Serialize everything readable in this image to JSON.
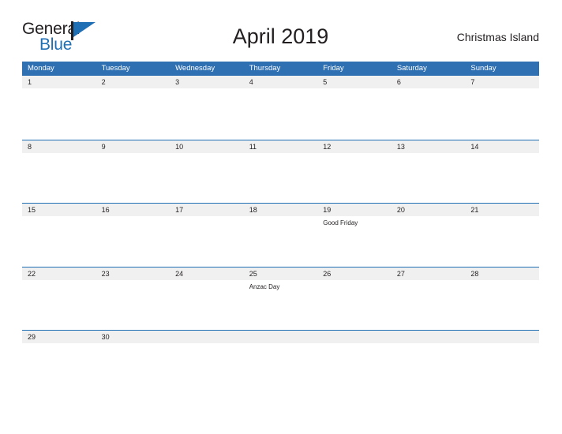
{
  "brand": {
    "name_part1": "General",
    "name_part2": "Blue",
    "accent_color": "#1f6fb5"
  },
  "header": {
    "title": "April 2019",
    "location": "Christmas Island"
  },
  "calendar": {
    "header_bg": "#2f70b3",
    "band_bg": "#f0f0f0",
    "rule_color": "#1f6fb5",
    "weekdays": [
      "Monday",
      "Tuesday",
      "Wednesday",
      "Thursday",
      "Friday",
      "Saturday",
      "Sunday"
    ],
    "weeks": [
      [
        {
          "date": "1",
          "events": []
        },
        {
          "date": "2",
          "events": []
        },
        {
          "date": "3",
          "events": []
        },
        {
          "date": "4",
          "events": []
        },
        {
          "date": "5",
          "events": []
        },
        {
          "date": "6",
          "events": []
        },
        {
          "date": "7",
          "events": []
        }
      ],
      [
        {
          "date": "8",
          "events": []
        },
        {
          "date": "9",
          "events": []
        },
        {
          "date": "10",
          "events": []
        },
        {
          "date": "11",
          "events": []
        },
        {
          "date": "12",
          "events": []
        },
        {
          "date": "13",
          "events": []
        },
        {
          "date": "14",
          "events": []
        }
      ],
      [
        {
          "date": "15",
          "events": []
        },
        {
          "date": "16",
          "events": []
        },
        {
          "date": "17",
          "events": []
        },
        {
          "date": "18",
          "events": []
        },
        {
          "date": "19",
          "events": [
            "Good Friday"
          ]
        },
        {
          "date": "20",
          "events": []
        },
        {
          "date": "21",
          "events": []
        }
      ],
      [
        {
          "date": "22",
          "events": []
        },
        {
          "date": "23",
          "events": []
        },
        {
          "date": "24",
          "events": []
        },
        {
          "date": "25",
          "events": [
            "Anzac Day"
          ]
        },
        {
          "date": "26",
          "events": []
        },
        {
          "date": "27",
          "events": []
        },
        {
          "date": "28",
          "events": []
        }
      ],
      [
        {
          "date": "29",
          "events": []
        },
        {
          "date": "30",
          "events": []
        },
        {
          "date": "",
          "events": []
        },
        {
          "date": "",
          "events": []
        },
        {
          "date": "",
          "events": []
        },
        {
          "date": "",
          "events": []
        },
        {
          "date": "",
          "events": []
        }
      ]
    ]
  }
}
